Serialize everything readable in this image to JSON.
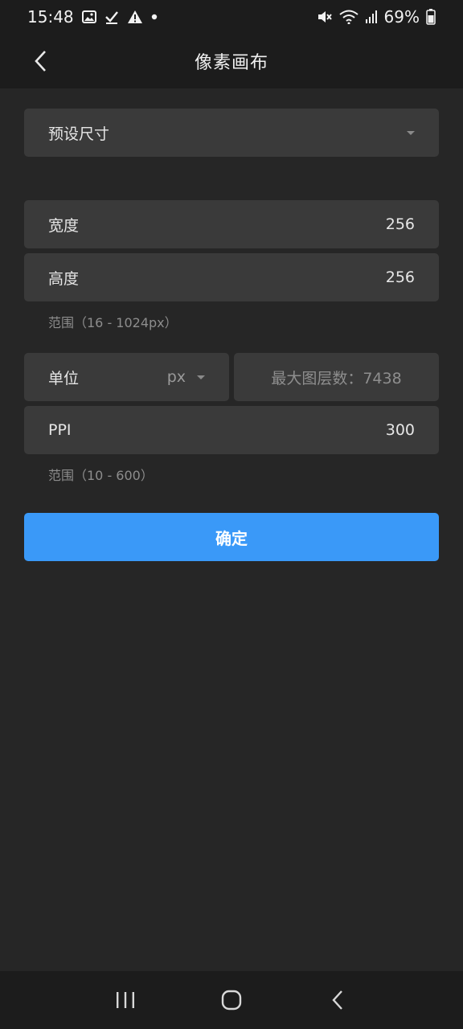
{
  "status_bar": {
    "time": "15:48",
    "battery": "69%",
    "icons_left": [
      "image-icon",
      "check-icon",
      "warning-icon",
      "dot-icon"
    ],
    "icons_right": [
      "mute-icon",
      "wifi-icon",
      "signal-icon",
      "battery-icon"
    ]
  },
  "app_bar": {
    "title": "像素画布"
  },
  "preset": {
    "label": "预设尺寸"
  },
  "width": {
    "label": "宽度",
    "value": "256"
  },
  "height": {
    "label": "高度",
    "value": "256"
  },
  "size_hint": "范围（16 - 1024px）",
  "unit": {
    "label": "单位",
    "value": "px"
  },
  "max_layers": "最大图层数：7438",
  "ppi": {
    "label": "PPI",
    "value": "300"
  },
  "ppi_hint": "范围（10 - 600）",
  "confirm_label": "确定",
  "nav_bar": {
    "buttons": [
      "recent-apps-icon",
      "home-icon",
      "back-icon"
    ]
  }
}
